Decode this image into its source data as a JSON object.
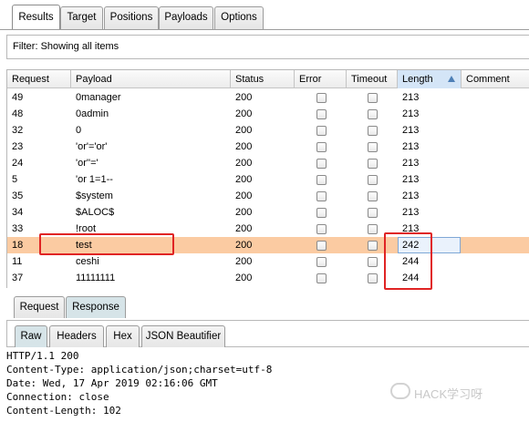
{
  "tabs": [
    "Results",
    "Target",
    "Positions",
    "Payloads",
    "Options"
  ],
  "filter": {
    "label": "Filter:",
    "text": "Showing all items"
  },
  "table": {
    "columns": [
      "Request",
      "Payload",
      "Status",
      "Error",
      "Timeout",
      "Length",
      "Comment"
    ],
    "sorted_column": "Length",
    "rows": [
      {
        "request": "49",
        "payload": "0manager",
        "status": "200",
        "error": false,
        "timeout": false,
        "length": "213"
      },
      {
        "request": "48",
        "payload": "0admin",
        "status": "200",
        "error": false,
        "timeout": false,
        "length": "213"
      },
      {
        "request": "32",
        "payload": "0",
        "status": "200",
        "error": false,
        "timeout": false,
        "length": "213"
      },
      {
        "request": "23",
        "payload": "'or'='or'",
        "status": "200",
        "error": false,
        "timeout": false,
        "length": "213"
      },
      {
        "request": "24",
        "payload": "'or''='",
        "status": "200",
        "error": false,
        "timeout": false,
        "length": "213"
      },
      {
        "request": "5",
        "payload": "'or 1=1--",
        "status": "200",
        "error": false,
        "timeout": false,
        "length": "213"
      },
      {
        "request": "35",
        "payload": "$system",
        "status": "200",
        "error": false,
        "timeout": false,
        "length": "213"
      },
      {
        "request": "34",
        "payload": "$ALOC$",
        "status": "200",
        "error": false,
        "timeout": false,
        "length": "213"
      },
      {
        "request": "33",
        "payload": "!root",
        "status": "200",
        "error": false,
        "timeout": false,
        "length": "213"
      },
      {
        "request": "18",
        "payload": "test",
        "status": "200",
        "error": false,
        "timeout": false,
        "length": "242",
        "selected": true
      },
      {
        "request": "11",
        "payload": "ceshi",
        "status": "200",
        "error": false,
        "timeout": false,
        "length": "244"
      },
      {
        "request": "37",
        "payload": "11111111",
        "status": "200",
        "error": false,
        "timeout": false,
        "length": "244"
      }
    ]
  },
  "req_resp_tabs": [
    "Request",
    "Response"
  ],
  "response_tabs": [
    "Raw",
    "Headers",
    "Hex",
    "JSON Beautifier"
  ],
  "response_lines": [
    "HTTP/1.1 200",
    "Content-Type: application/json;charset=utf-8",
    "Date: Wed, 17 Apr 2019 02:16:06 GMT",
    "Connection: close",
    "Content-Length: 102"
  ],
  "watermark": "HACK学习呀",
  "colors": {
    "selected_row": "#fbcba2",
    "highlight_box": "#e02424",
    "active_subtab": "#d6e4e8"
  }
}
